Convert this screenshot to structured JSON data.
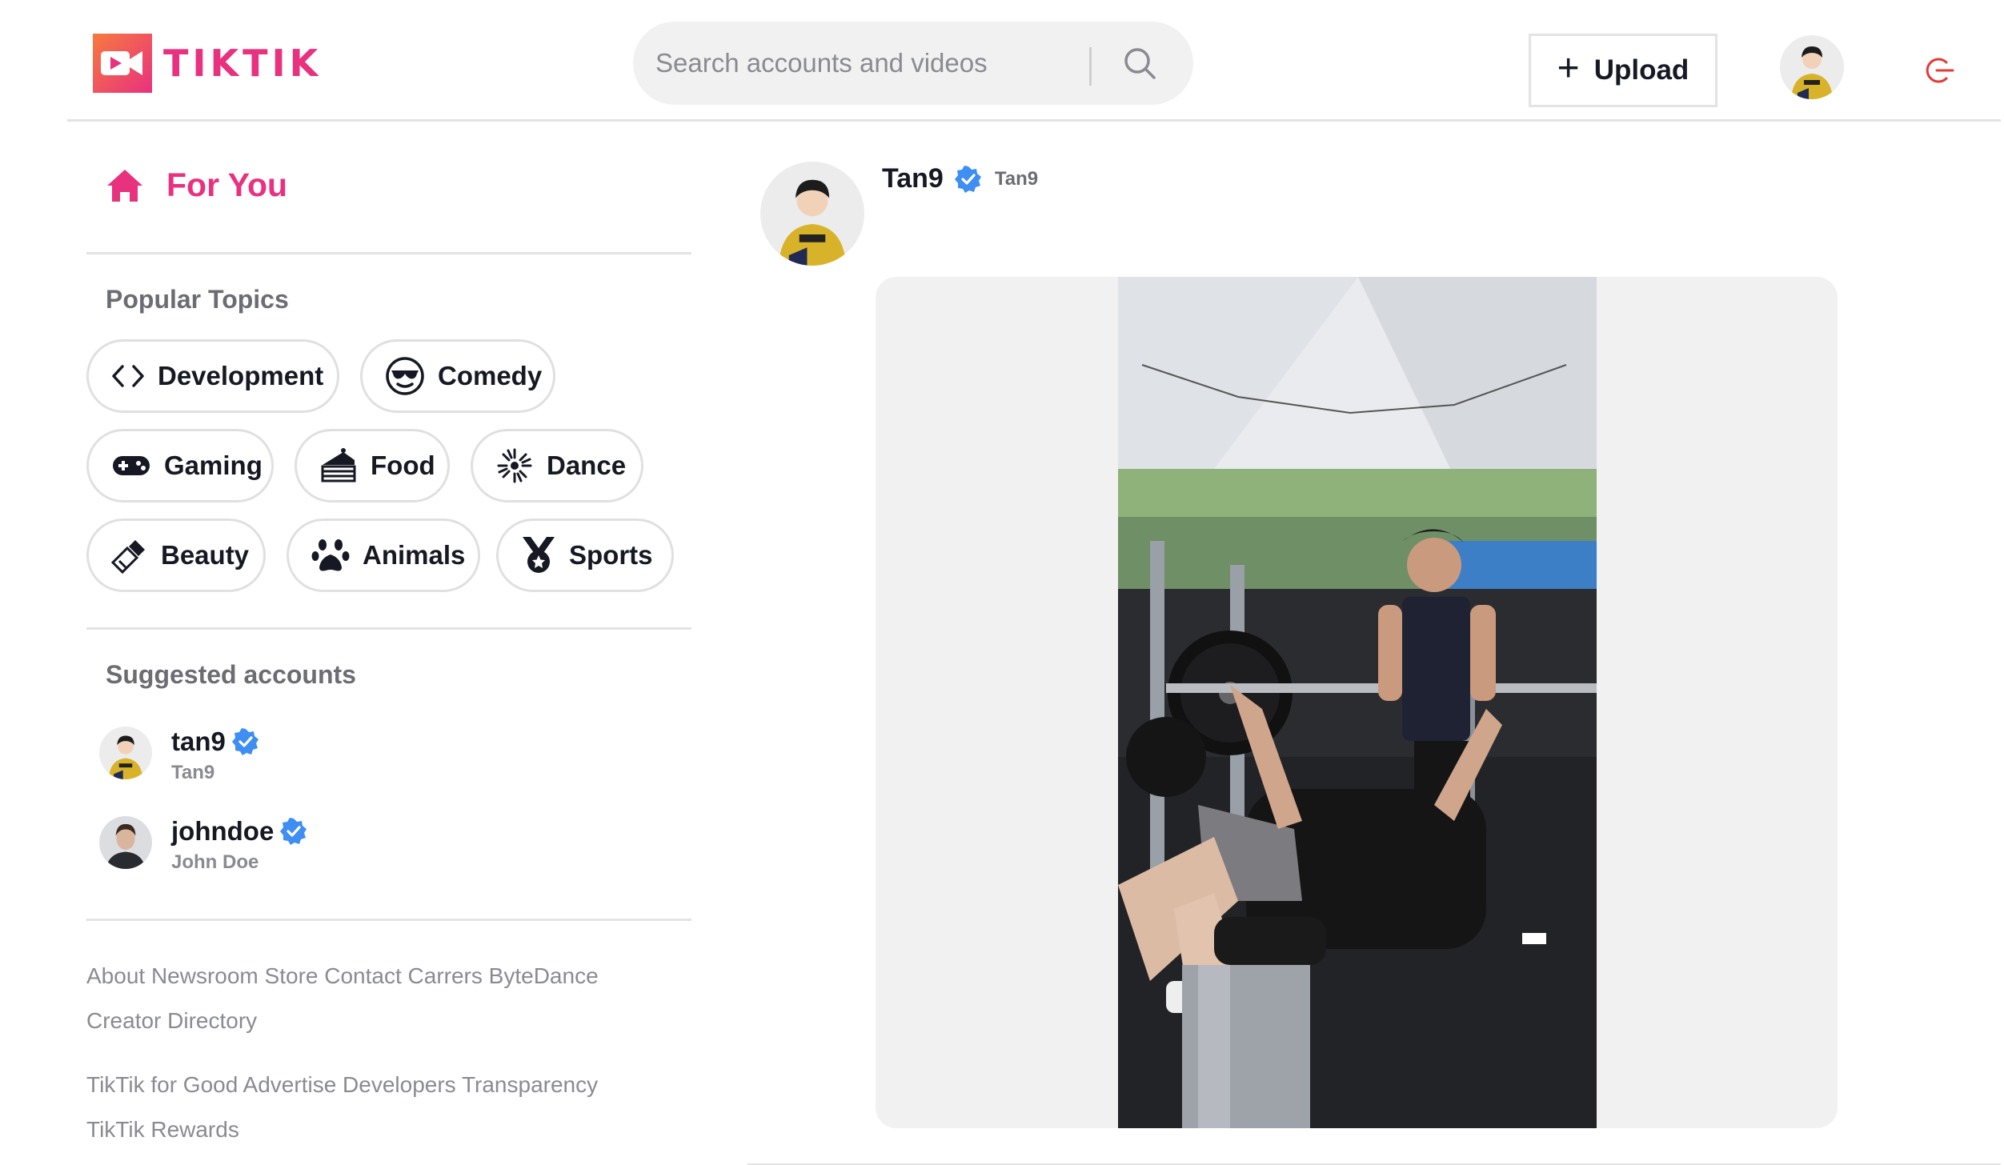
{
  "header": {
    "logo_text": "TIKTIK",
    "search": {
      "placeholder": "Search accounts and videos",
      "value": ""
    },
    "upload_label": "Upload",
    "brand_color": "#e8317f"
  },
  "sidebar": {
    "for_you_label": "For You",
    "popular_topics_title": "Popular Topics",
    "topics": [
      {
        "label": "Development",
        "icon": "code-icon"
      },
      {
        "label": "Comedy",
        "icon": "sunglasses-face-icon"
      },
      {
        "label": "Gaming",
        "icon": "gamepad-icon"
      },
      {
        "label": "Food",
        "icon": "cake-icon"
      },
      {
        "label": "Dance",
        "icon": "dance-burst-icon"
      },
      {
        "label": "Beauty",
        "icon": "lipstick-icon"
      },
      {
        "label": "Animals",
        "icon": "paw-icon"
      },
      {
        "label": "Sports",
        "icon": "medal-icon"
      }
    ],
    "suggested_title": "Suggested accounts",
    "accounts": [
      {
        "handle": "tan9",
        "name": "Tan9",
        "verified": true
      },
      {
        "handle": "johndoe",
        "name": "John Doe",
        "verified": true
      }
    ],
    "footer_row1": [
      "About",
      "Newsroom",
      "Store",
      "Contact",
      "Carrers",
      "ByteDance"
    ],
    "footer_row1b": "Creator Directory",
    "footer_row2": [
      "TikTik for Good",
      "Advertise",
      "Developers",
      "Transparency"
    ],
    "footer_row2b": "TikTik Rewards"
  },
  "post": {
    "handle": "Tan9",
    "name": "Tan9",
    "verified": true
  }
}
